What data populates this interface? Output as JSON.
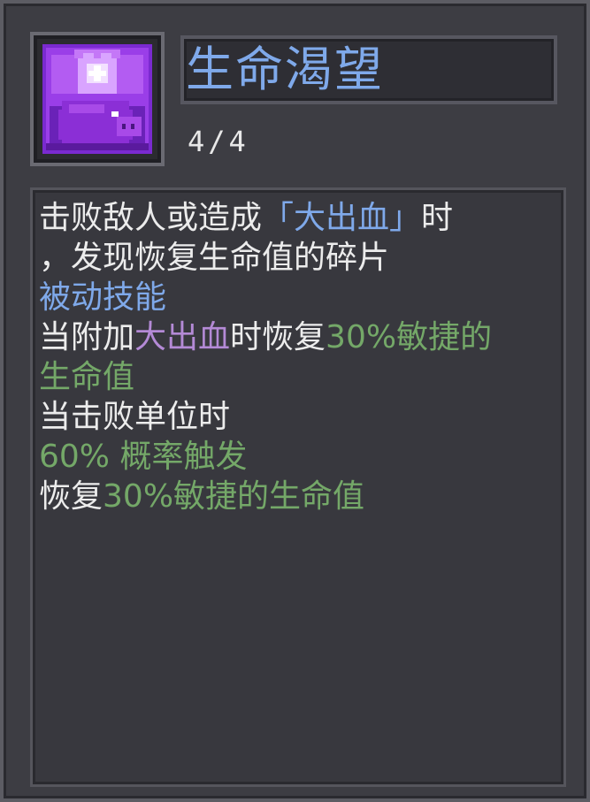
{
  "skill": {
    "name": "生命渴望",
    "level": "4/4",
    "icon": "purple-pig-heart-icon"
  },
  "description": {
    "line1_a": "击败敌人或造成",
    "line1_b": "「大出血」",
    "line1_c": "时",
    "line2": "，发现恢复生命值的碎片",
    "line3": "被动技能",
    "line4_a": "当附加",
    "line4_b": "大出血",
    "line4_c": "时恢复",
    "line4_d": "30%敏捷的",
    "line5": "生命值",
    "line6": "当击败单位时",
    "line7": "60% 概率触发",
    "line8_a": "恢复",
    "line8_b": "30%敏捷的生命值"
  },
  "colors": {
    "keyword_blue": "#7fa9ea",
    "bleed_purple": "#b48ad6",
    "value_green": "#74a868",
    "text_white": "#ececec",
    "panel_bg": "#3d3d43"
  }
}
